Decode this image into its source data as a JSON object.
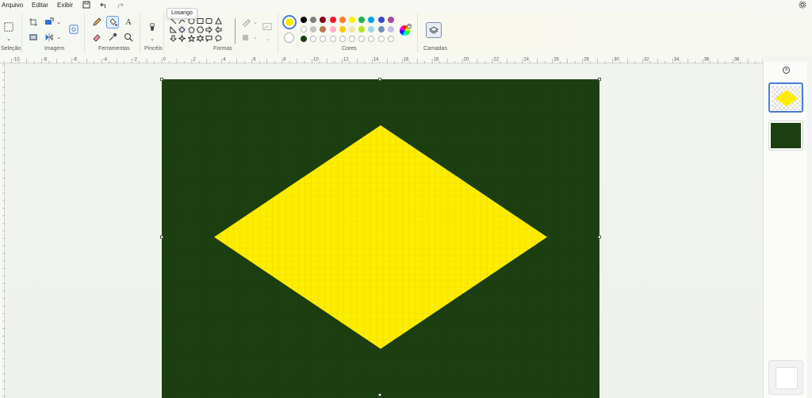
{
  "menu": {
    "arquivo": "Arquivo",
    "editar": "Editar",
    "exibir": "Exibir"
  },
  "tooltip": "Losango",
  "groups": {
    "selecao": "Seleção",
    "imagem": "Imagem",
    "ferramentas": "Ferramentas",
    "pinceis": "Pincéis",
    "formas": "Formas",
    "cores": "Cores",
    "camadas": "Camadas"
  },
  "ferramentas": {
    "text_glyph": "A"
  },
  "colors": {
    "primary": "#ffed00",
    "secondary": "#ffffff",
    "palette_row1": [
      "#000000",
      "#7f7f7f",
      "#88001b",
      "#ed1c24",
      "#ff7f27",
      "#fff200",
      "#22b14c",
      "#00a2e8",
      "#3f48cc",
      "#a349a4"
    ],
    "palette_row2": [
      "#ffffff",
      "#c3c3c3",
      "#b97a57",
      "#ffaec9",
      "#ffc90e",
      "#efe4b0",
      "#b5e61d",
      "#99d9ea",
      "#7092be",
      "#c8bfe7"
    ],
    "palette_row3_first": "#1c3f11"
  },
  "hruler_labels": [
    "-10",
    "-8",
    "-6",
    "-4",
    "-2",
    "0",
    "2",
    "4",
    "6",
    "8",
    "10",
    "12",
    "14",
    "16",
    "18",
    "20",
    "22",
    "24",
    "26",
    "28",
    "30",
    "32",
    "34",
    "36",
    "38"
  ],
  "canvas": {
    "background": "#1c3f11",
    "diamond_fill": "#ffed00"
  },
  "layers": [
    {
      "name": "layer-diamond",
      "selected": true
    },
    {
      "name": "layer-background",
      "selected": false
    }
  ]
}
